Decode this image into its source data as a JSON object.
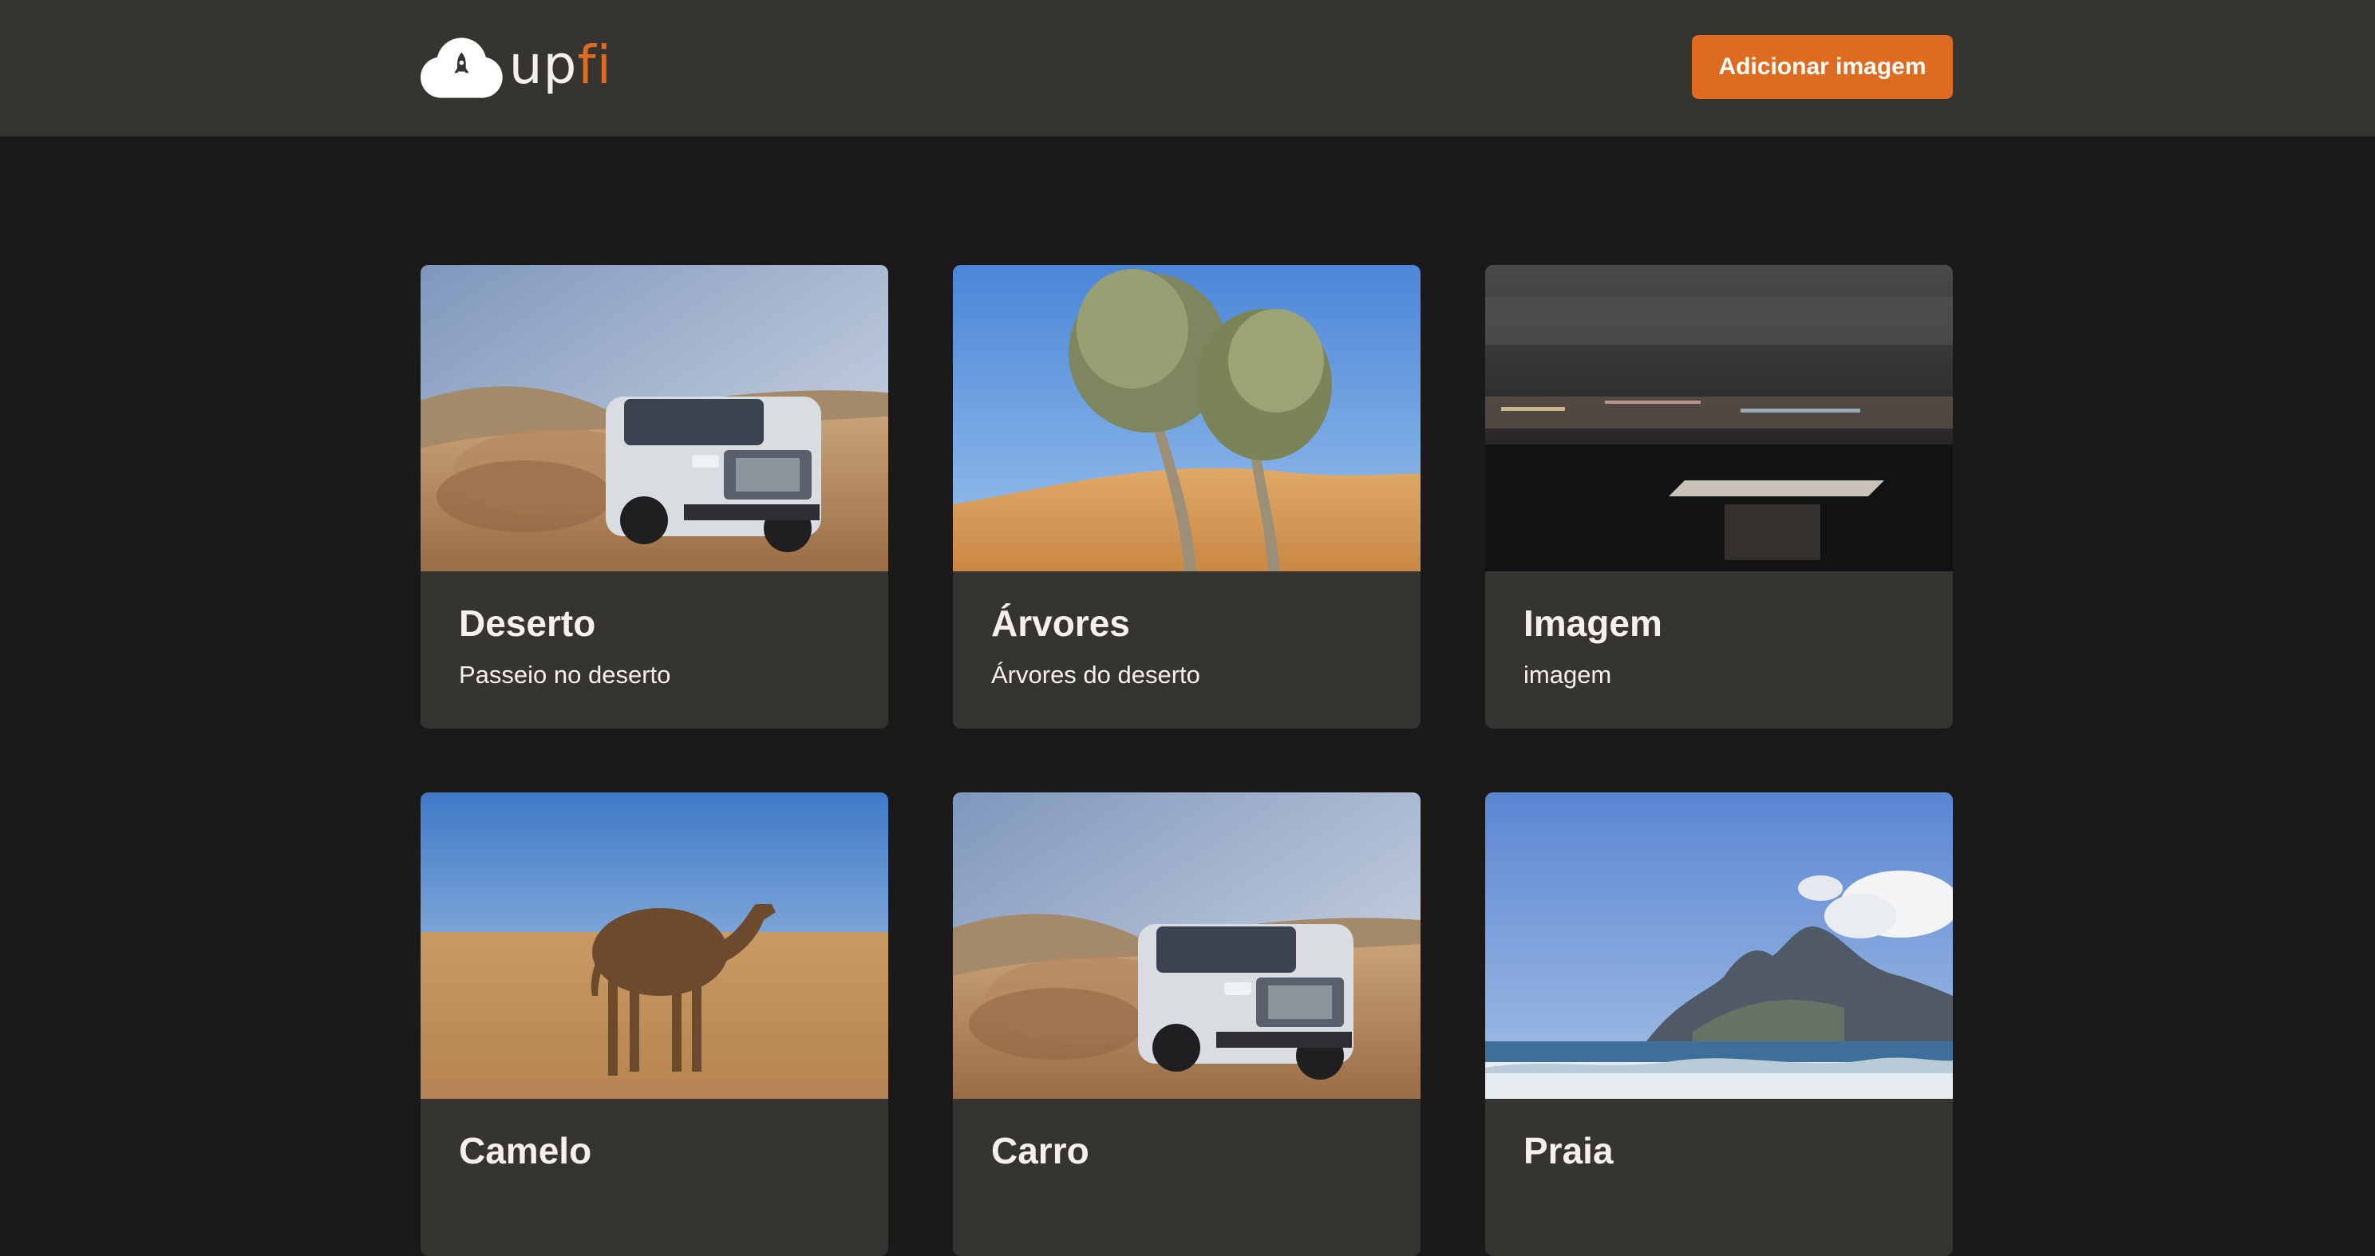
{
  "header": {
    "logo_text_up": "up",
    "logo_text_fi": "fi",
    "add_button_label": "Adicionar imagem",
    "accent_color": "#dd6b20"
  },
  "cards": [
    {
      "title": "Deserto",
      "description": "Passeio no deserto",
      "image": "desert-suv-photo"
    },
    {
      "title": "Árvores",
      "description": "Árvores do deserto",
      "image": "desert-trees-photo"
    },
    {
      "title": "Imagem",
      "description": "imagem",
      "image": "night-city-blur-photo"
    },
    {
      "title": "Camelo",
      "description": "",
      "image": "camel-photo"
    },
    {
      "title": "Carro",
      "description": "",
      "image": "desert-suv-photo"
    },
    {
      "title": "Praia",
      "description": "",
      "image": "beach-mountain-photo"
    }
  ]
}
